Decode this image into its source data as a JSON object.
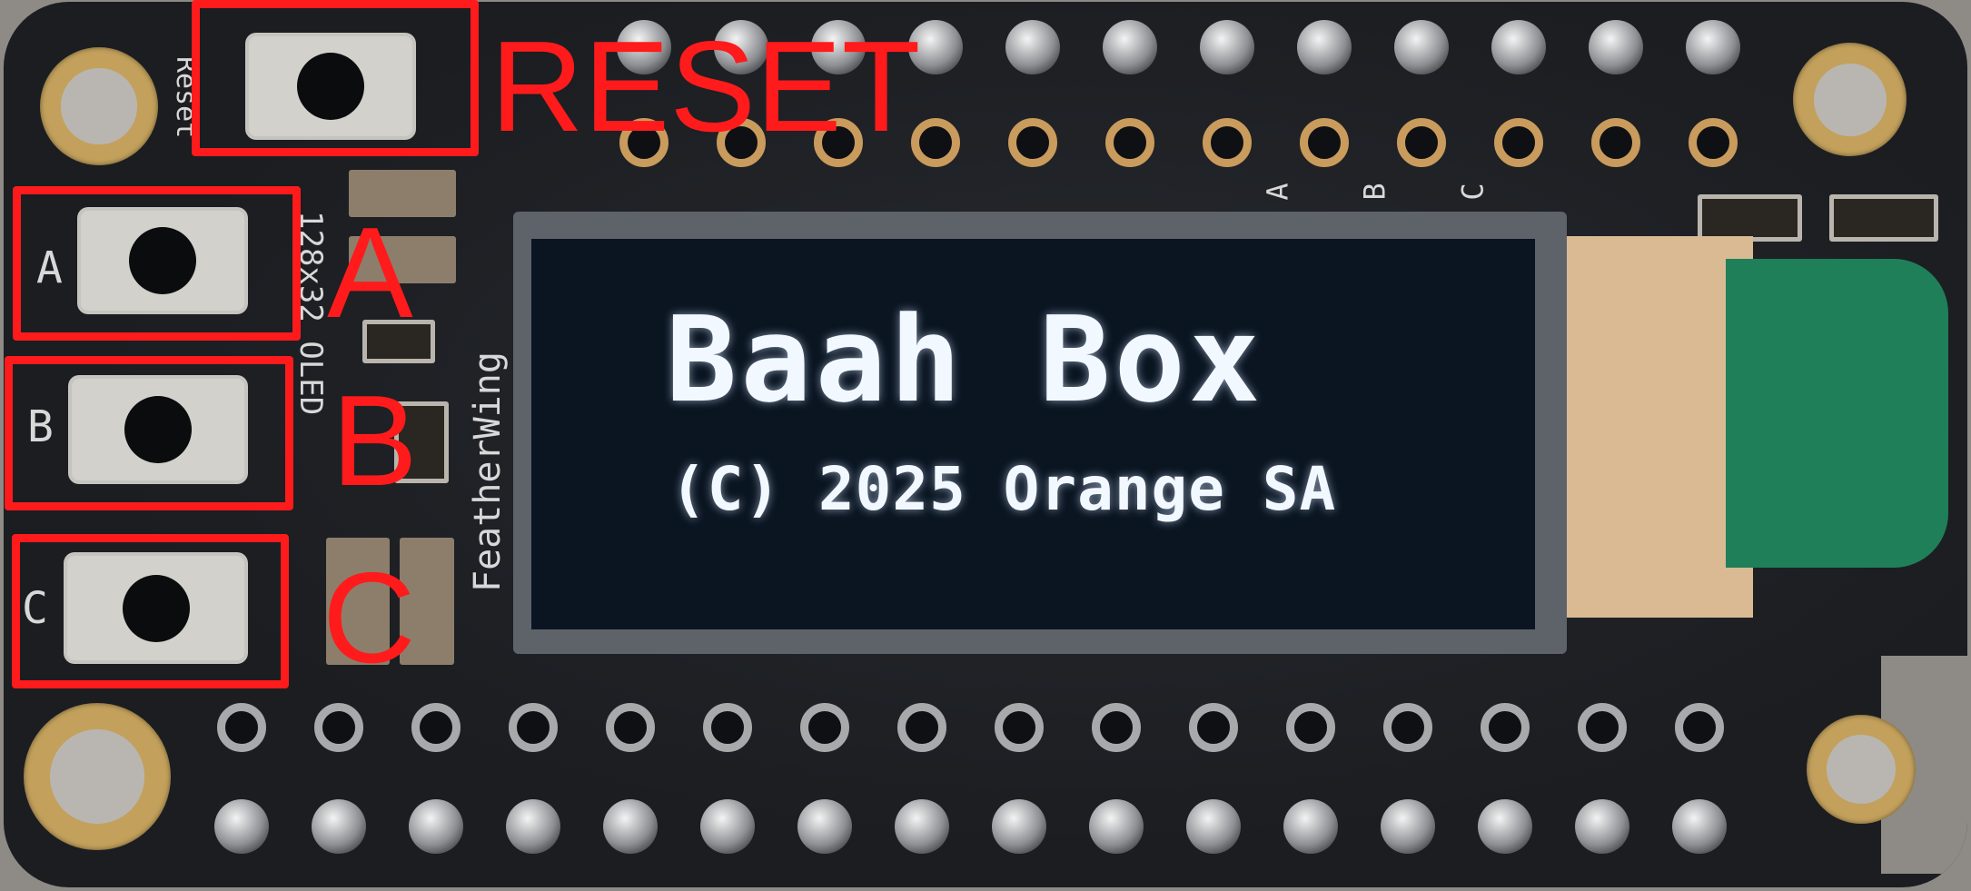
{
  "image": {
    "type": "photo of an OLED FeatherWing board with red annotations",
    "colors": {
      "annotation": "#ff1b1b",
      "pcb": "#1b1d21",
      "screen": "#0b1522",
      "oled_text": "#f2f8ff",
      "pad_gold": "#c99b5c"
    }
  },
  "annotations": {
    "reset_label": "RESET",
    "a_label": "A",
    "b_label": "B",
    "c_label": "C"
  },
  "silkscreen": {
    "reset": "Reset",
    "btn_a": "A",
    "btn_b": "B",
    "btn_c": "C",
    "featherwing": "FeatherWing",
    "model": "128x32 OLED",
    "pin_a": "A",
    "pin_b": "B",
    "pin_c": "C"
  },
  "oled": {
    "title": "Baah Box",
    "subtitle": "(C) 2025 Orange SA"
  }
}
